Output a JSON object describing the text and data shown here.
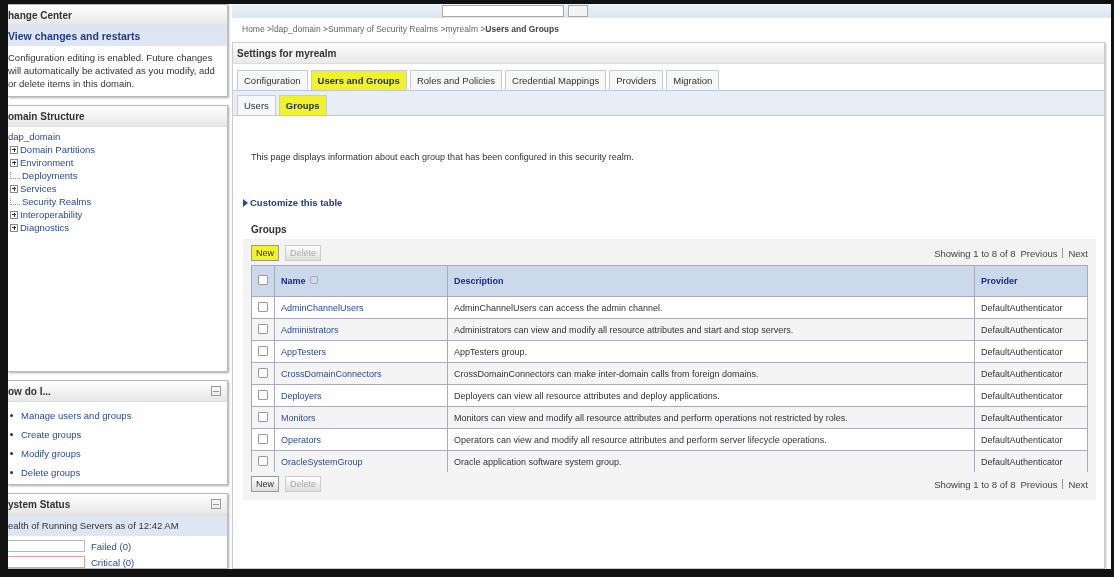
{
  "change_center": {
    "title": "hange Center",
    "link": "View changes and restarts",
    "message": "Configuration editing is enabled. Future changes will automatically be activated as you modify, add or delete items in this domain."
  },
  "domain_structure": {
    "title": "omain Structure",
    "root": "dap_domain",
    "children": [
      {
        "label": "Domain Partitions",
        "expandable": true
      },
      {
        "label": "Environment",
        "expandable": true
      },
      {
        "label": "Deployments",
        "expandable": false
      },
      {
        "label": "Services",
        "expandable": true
      },
      {
        "label": "Security Realms",
        "expandable": false
      },
      {
        "label": "Interoperability",
        "expandable": true
      },
      {
        "label": "Diagnostics",
        "expandable": true
      }
    ]
  },
  "how_do_i": {
    "title": "ow do I...",
    "links": [
      "Manage users and groups",
      "Create groups",
      "Modify groups",
      "Delete groups"
    ]
  },
  "system_status": {
    "title": "ystem Status",
    "health": "ealth of Running Servers as of  12:42 AM",
    "bars": [
      {
        "label": "Failed (0)",
        "level": 0
      },
      {
        "label": "Critical (0)",
        "level": 0
      }
    ]
  },
  "breadcrumb": "Home >ldap_domain >Summary of Security Realms >myrealm >**Users and Groups**",
  "settings": {
    "title": "Settings for myrealm",
    "tabs": [
      {
        "label": "Configuration",
        "selected": false,
        "highlighted": false
      },
      {
        "label": "Users and Groups",
        "selected": true,
        "highlighted": true
      },
      {
        "label": "Roles and Policies",
        "selected": false,
        "highlighted": false
      },
      {
        "label": "Credential Mappings",
        "selected": false,
        "highlighted": false
      },
      {
        "label": "Providers",
        "selected": false,
        "highlighted": false
      },
      {
        "label": "Migration",
        "selected": false,
        "highlighted": false
      }
    ],
    "subtabs": [
      {
        "label": "Users",
        "selected": false,
        "highlighted": false
      },
      {
        "label": "Groups",
        "selected": true,
        "highlighted": true
      }
    ],
    "description": "This page displays information about each group that has been configured in this security realm.",
    "customize": "Customize this table",
    "table": {
      "title": "Groups",
      "top_buttons": [
        {
          "label": "New",
          "disabled": false,
          "highlighted": true
        },
        {
          "label": "Delete",
          "disabled": true,
          "highlighted": false
        }
      ],
      "bottom_buttons": [
        {
          "label": "New",
          "disabled": false,
          "highlighted": false
        },
        {
          "label": "Delete",
          "disabled": true,
          "highlighted": false
        }
      ],
      "paging_top": {
        "showing": "Showing 1 to 8 of 8",
        "previous": "Previous",
        "next": "Next"
      },
      "paging_bottom": {
        "showing": "Showing 1 to 8 of 8",
        "previous": "Previous",
        "next": "Next"
      },
      "all_checked": false,
      "columns": [
        "Name",
        "Description",
        "Provider"
      ],
      "rows": [
        {
          "checked": false,
          "name": "AdminChannelUsers",
          "description": "AdminChannelUsers can access the admin channel.",
          "provider": "DefaultAuthenticator"
        },
        {
          "checked": false,
          "name": "Administrators",
          "description": "Administrators can view and modify all resource attributes and start and stop servers.",
          "provider": "DefaultAuthenticator"
        },
        {
          "checked": false,
          "name": "AppTesters",
          "description": "AppTesters group.",
          "provider": "DefaultAuthenticator"
        },
        {
          "checked": false,
          "name": "CrossDomainConnectors",
          "description": "CrossDomainConnectors can make inter-domain calls from foreign domains.",
          "provider": "DefaultAuthenticator"
        },
        {
          "checked": false,
          "name": "Deployers",
          "description": "Deployers can view all resource attributes and deploy applications.",
          "provider": "DefaultAuthenticator"
        },
        {
          "checked": false,
          "name": "Monitors",
          "description": "Monitors can view and modify all resource attributes and perform operations not restricted by roles.",
          "provider": "DefaultAuthenticator"
        },
        {
          "checked": false,
          "name": "Operators",
          "description": "Operators can view and modify all resource attributes and perform server lifecycle operations.",
          "provider": "DefaultAuthenticator"
        },
        {
          "checked": false,
          "name": "OracleSystemGroup",
          "description": "Oracle application software system group.",
          "provider": "DefaultAuthenticator"
        }
      ]
    }
  }
}
